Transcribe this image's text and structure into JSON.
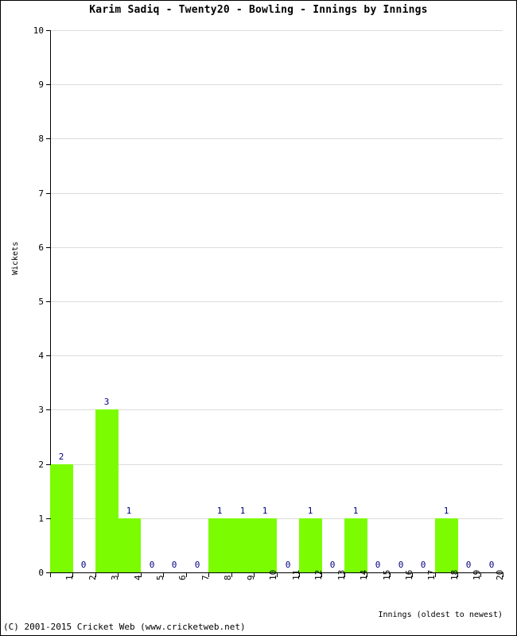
{
  "chart_data": {
    "type": "bar",
    "title": "Karim Sadiq - Twenty20 - Bowling - Innings by Innings",
    "xlabel": "Innings (oldest to newest)",
    "ylabel": "Wickets",
    "categories": [
      "1",
      "2",
      "3",
      "4",
      "5",
      "6",
      "7",
      "8",
      "9",
      "10",
      "11",
      "12",
      "13",
      "14",
      "15",
      "16",
      "17",
      "18",
      "19",
      "20"
    ],
    "values": [
      2,
      0,
      3,
      1,
      0,
      0,
      0,
      1,
      1,
      1,
      0,
      1,
      0,
      1,
      0,
      0,
      0,
      1,
      0,
      0
    ],
    "value_labels": [
      "2",
      "0",
      "3",
      "1",
      "0",
      "0",
      "0",
      "1",
      "1",
      "1",
      "0",
      "1",
      "0",
      "1",
      "0",
      "0",
      "0",
      "1",
      "0",
      "0"
    ],
    "ylim": [
      0,
      10
    ],
    "y_ticks": [
      0,
      1,
      2,
      3,
      4,
      5,
      6,
      7,
      8,
      9,
      10
    ],
    "y_tick_labels": [
      "0",
      "1",
      "2",
      "3",
      "4",
      "5",
      "6",
      "7",
      "8",
      "9",
      "10"
    ],
    "grid": true,
    "legend": null,
    "bar_color": "#7cfc00",
    "value_label_color": "#000080",
    "grid_color": "#dcdcdc",
    "axis_color": "#000000"
  },
  "footer": {
    "copyright": "(C) 2001-2015 Cricket Web (www.cricketweb.net)"
  }
}
